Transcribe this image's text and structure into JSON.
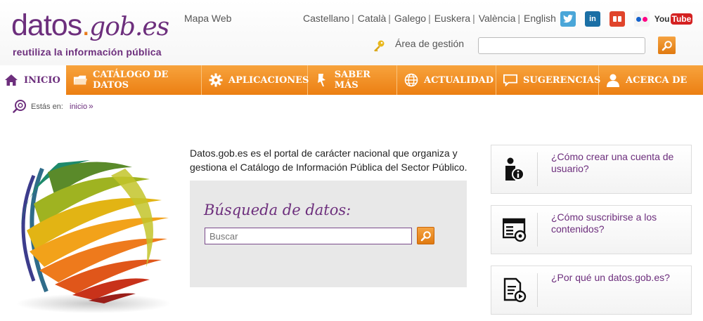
{
  "header": {
    "logo_main": "datos",
    "logo_dot": ".",
    "logo_gob": "gob.es",
    "logo_tagline": "reutiliza la información pública",
    "sitemap": "Mapa Web",
    "languages": [
      "Castellano",
      "Català",
      "Galego",
      "Euskera",
      "València",
      "English"
    ],
    "lang_separator": "|",
    "social": {
      "linkedin": "in",
      "youtube_you": "You",
      "youtube_tube": "Tube"
    },
    "management": "Área de gestión",
    "search_value": ""
  },
  "nav": {
    "items": [
      {
        "label": "INICIO",
        "icon": "home-icon",
        "width": 94
      },
      {
        "label": "CATÁLOGO DE DATOS",
        "icon": "folder-icon",
        "width": 193
      },
      {
        "label": "APLICACIONES",
        "icon": "gear-icon",
        "width": 151
      },
      {
        "label": "SABER MÁS",
        "icon": "pin-icon",
        "width": 127
      },
      {
        "label": "ACTUALIDAD",
        "icon": "globe-icon",
        "width": 141
      },
      {
        "label": "SUGERENCIAS",
        "icon": "speech-bubble-icon",
        "width": 146
      },
      {
        "label": "ACERCA DE",
        "icon": "person-icon",
        "width": 148
      }
    ]
  },
  "breadcrumb": {
    "label": "Estás en:",
    "current": "inicio",
    "separator": "»"
  },
  "intro": {
    "text": "Datos.gob.es es el portal de carácter nacional que organiza y gestiona el Catálogo de Información Pública del Sector Público."
  },
  "search": {
    "title": "Búsqueda de datos:",
    "placeholder": "Buscar"
  },
  "cards": [
    {
      "text": "¿Cómo crear una cuenta de usuario?",
      "icon": "user-info-icon"
    },
    {
      "text": "¿Cómo suscribirse a los contenidos?",
      "icon": "subscribe-window-icon"
    },
    {
      "text": "¿Por qué un datos.gob.es?",
      "icon": "document-play-icon"
    }
  ],
  "colors": {
    "brand_purple": "#6d2f7d",
    "accent_orange": "#ec7f12"
  }
}
